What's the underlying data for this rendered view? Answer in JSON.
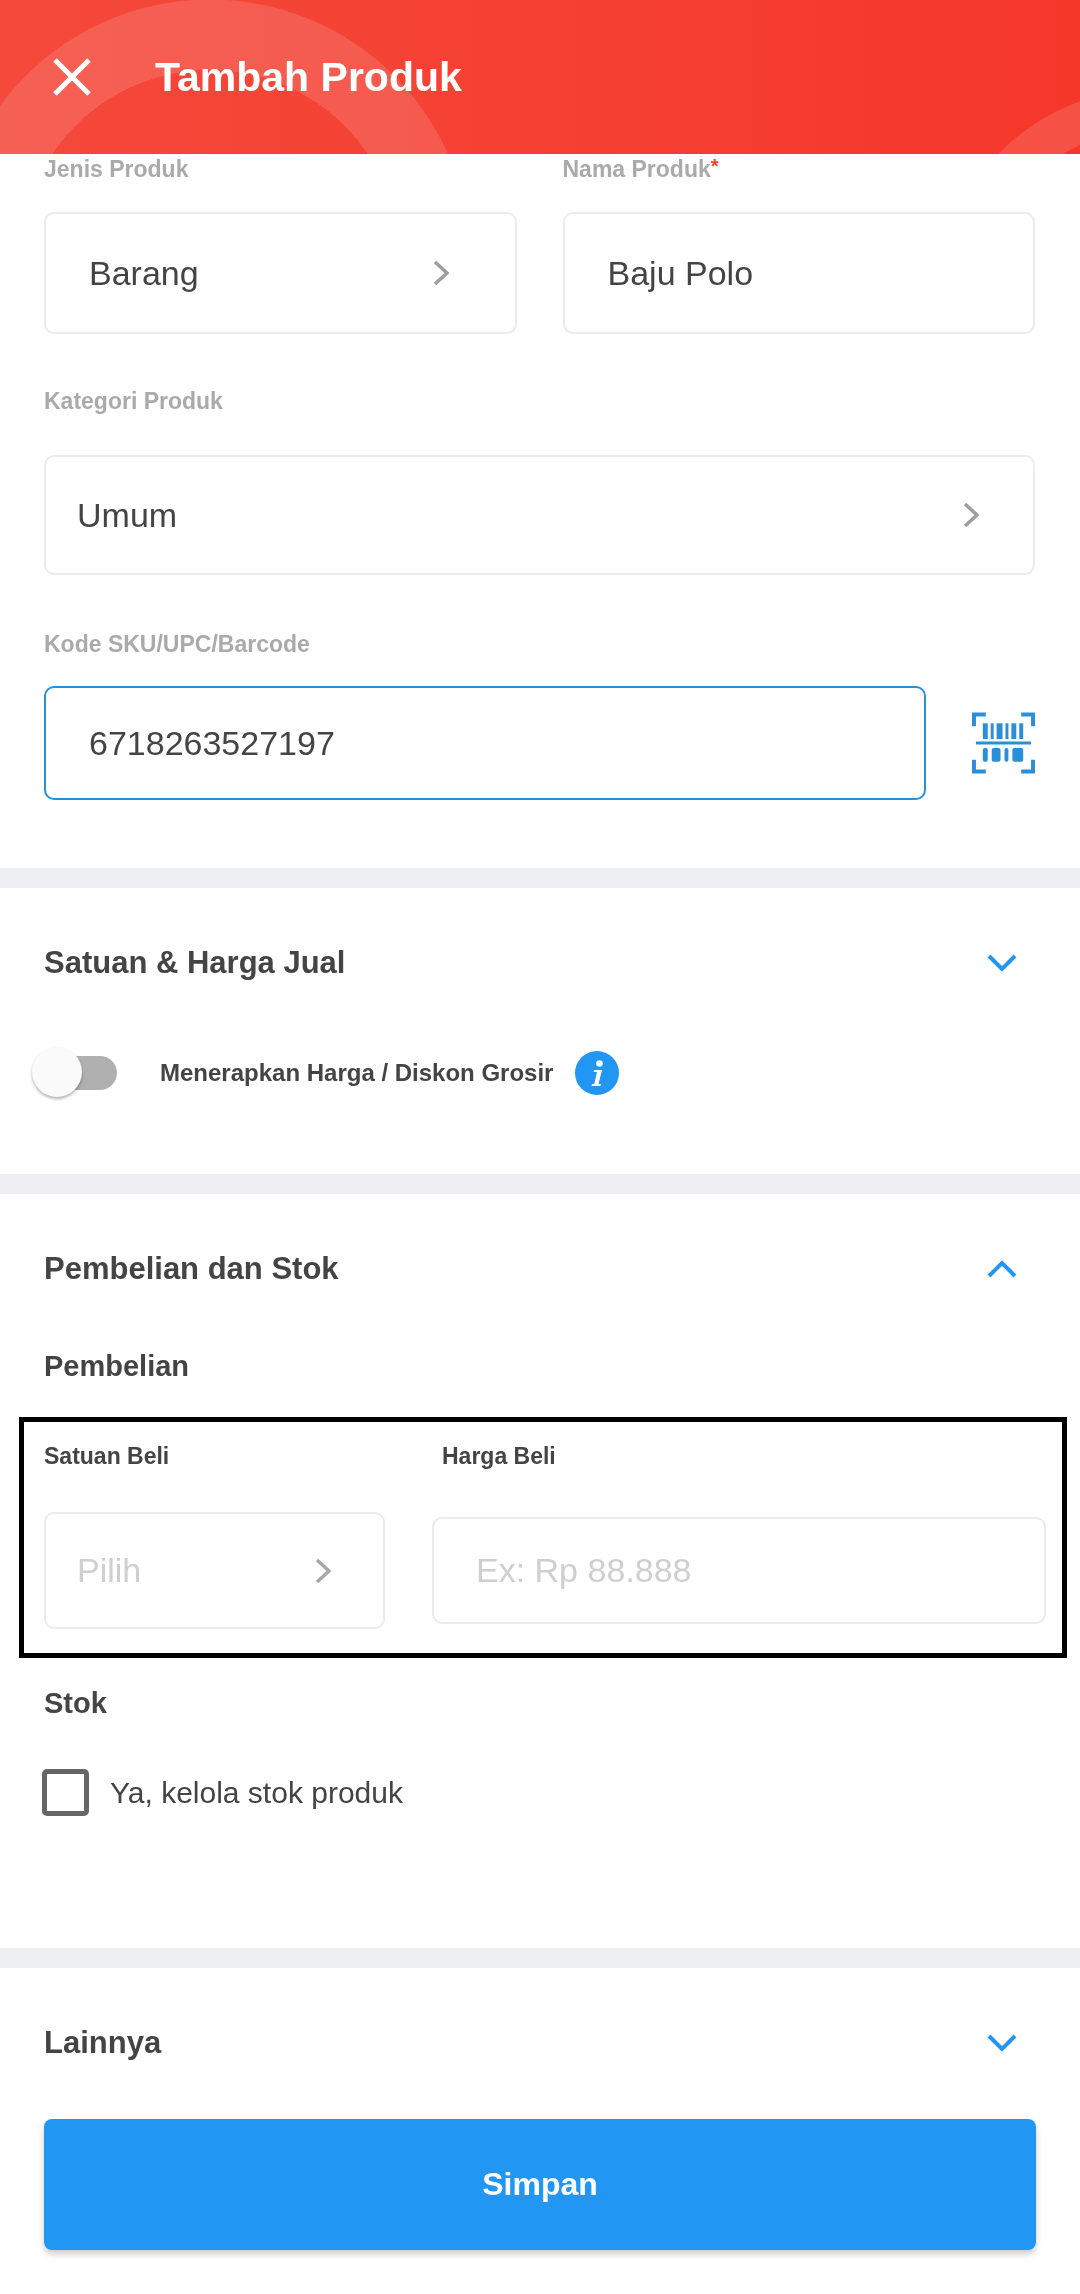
{
  "header": {
    "title": "Tambah Produk"
  },
  "product_fields": [
    {
      "label": "Jenis Produk",
      "kind": "select",
      "value": "Barang"
    },
    {
      "label": "Nama Produk",
      "required_mark": "*",
      "kind": "text",
      "value": "Baju Polo"
    }
  ],
  "category": {
    "label": "Kategori Produk",
    "value": "Umum"
  },
  "sku": {
    "label": "Kode SKU/UPC/Barcode",
    "value": "6718263527197",
    "focused": true
  },
  "sections": [
    {
      "kind": "price",
      "title": "Satuan & Harga Jual",
      "expanded": false,
      "wholesale_toggle": {
        "label": "Menerapkan Harga / Diskon Grosir",
        "on": false
      }
    },
    {
      "kind": "purchase",
      "title": "Pembelian dan Stok",
      "expanded": true,
      "purchase": {
        "heading": "Pembelian",
        "highlighted": true,
        "fields": [
          {
            "label": "Satuan Beli",
            "kind": "select",
            "placeholder": "Pilih"
          },
          {
            "label": "Harga Beli",
            "kind": "text",
            "placeholder": "Ex: Rp 88.888"
          }
        ]
      },
      "stock": {
        "heading": "Stok",
        "checkbox": {
          "label": "Ya, kelola stok produk",
          "checked": false
        }
      }
    },
    {
      "kind": "other",
      "title": "Lainnya",
      "expanded": false
    }
  ],
  "save_button": {
    "label": "Simpan"
  }
}
